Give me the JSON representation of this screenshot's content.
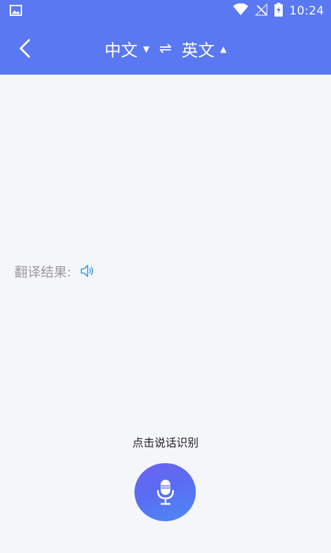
{
  "status": {
    "time": "10:24"
  },
  "toolbar": {
    "source_lang": "中文",
    "target_lang": "英文",
    "swap_symbol": "⇌"
  },
  "result": {
    "label": "翻译结果:"
  },
  "voice": {
    "hint": "点击说话识别"
  },
  "colors": {
    "primary": "#5a78f2",
    "background": "#f5f6f9",
    "speaker": "#3aa0e0"
  }
}
